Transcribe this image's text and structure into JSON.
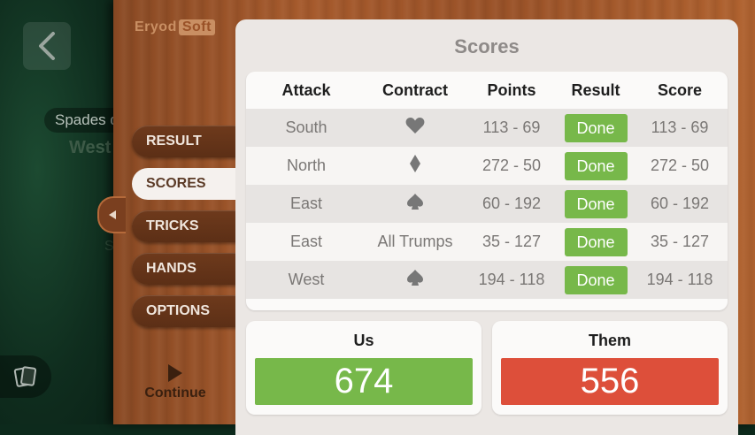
{
  "background": {
    "pill_text": "Spades d",
    "player_text": "West",
    "small_text": "S"
  },
  "logo": {
    "part1": "Eryod",
    "part2": "Soft"
  },
  "menu": {
    "items": [
      {
        "label": "RESULT"
      },
      {
        "label": "SCORES"
      },
      {
        "label": "TRICKS"
      },
      {
        "label": "HANDS"
      },
      {
        "label": "OPTIONS"
      }
    ],
    "active": "SCORES",
    "continue_label": "Continue"
  },
  "scores": {
    "title": "Scores",
    "headers": [
      "Attack",
      "Contract",
      "Points",
      "Result",
      "Score"
    ],
    "rows": [
      {
        "attack": "South",
        "contract": "",
        "contract_icon": "heart-icon",
        "points": "113 - 69",
        "result": "Done",
        "score": "113 - 69"
      },
      {
        "attack": "North",
        "contract": "",
        "contract_icon": "diamond-icon",
        "points": "272 - 50",
        "result": "Done",
        "score": "272 - 50"
      },
      {
        "attack": "East",
        "contract": "",
        "contract_icon": "spade-icon",
        "points": "60 - 192",
        "result": "Done",
        "score": "60 - 192"
      },
      {
        "attack": "East",
        "contract": "All Trumps",
        "contract_icon": "",
        "points": "35 - 127",
        "result": "Done",
        "score": "35 - 127"
      },
      {
        "attack": "West",
        "contract": "",
        "contract_icon": "spade-icon",
        "points": "194 - 118",
        "result": "Done",
        "score": "194 - 118"
      }
    ],
    "us": {
      "label": "Us",
      "total": "674",
      "color": "#77b84a"
    },
    "them": {
      "label": "Them",
      "total": "556",
      "color": "#dd4f3a"
    }
  },
  "colors": {
    "done_green": "#77b84a",
    "them_red": "#dd4f3a",
    "wood": "#a65a2c"
  }
}
